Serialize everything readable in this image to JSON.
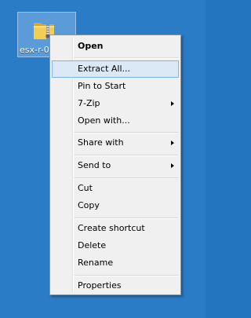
{
  "desktop": {
    "background_color": "#2a7cc6",
    "icon": {
      "label": "esx-r-0",
      "icon_name": "zip-folder-icon"
    }
  },
  "context_menu": {
    "highlight_color": "#dbe9f7",
    "items": [
      {
        "label": "Open",
        "bold": true
      },
      {
        "label": "Extract All...",
        "highlighted": true
      },
      {
        "label": "Pin to Start"
      },
      {
        "label": "7-Zip",
        "submenu": true
      },
      {
        "label": "Open with..."
      },
      {
        "label": "Share with",
        "submenu": true
      },
      {
        "label": "Send to",
        "submenu": true
      },
      {
        "label": "Cut"
      },
      {
        "label": "Copy"
      },
      {
        "label": "Create shortcut"
      },
      {
        "label": "Delete"
      },
      {
        "label": "Rename"
      },
      {
        "label": "Properties"
      }
    ]
  }
}
